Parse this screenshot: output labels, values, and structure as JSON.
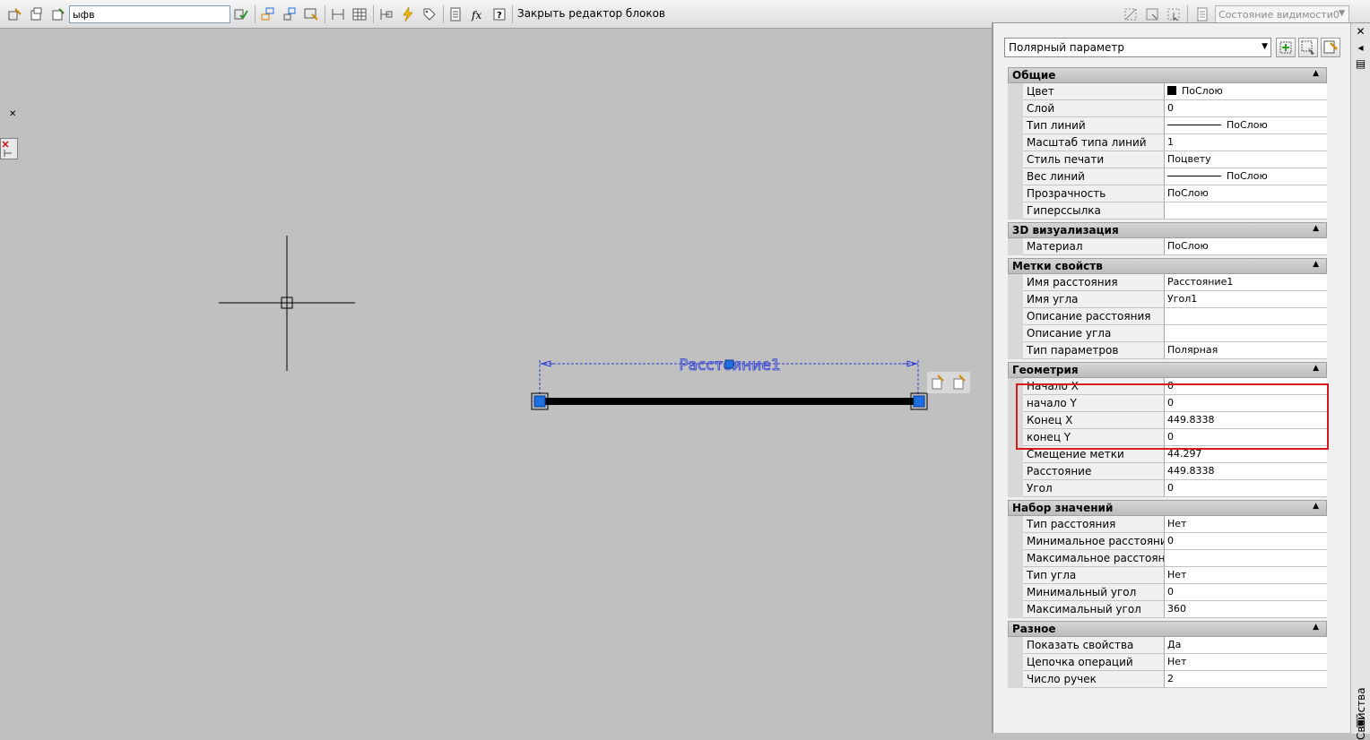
{
  "toolbar": {
    "block_name_value": "ыфв",
    "close_editor_label": "Закрыть редактор блоков",
    "visibility_state_value": "Состояние видимости0",
    "icons": [
      "edit-block-icon",
      "save-block-icon",
      "save-as-icon",
      "test-block-icon",
      "authoring-palette-icon",
      "parameter-sets-icon",
      "constraint-icon",
      "define-attribute-icon",
      "block-table-icon",
      "parameter-manager-icon",
      "lightning-icon",
      "tag-icon",
      "properties-icon",
      "fx-icon",
      "help-icon"
    ]
  },
  "drawing": {
    "parameter_label": "Расстояние1"
  },
  "properties": {
    "object_type": "Полярный параметр",
    "side_label": "Свойства",
    "categories": [
      {
        "title": "Общие",
        "rows": [
          {
            "name": "Цвет",
            "value": "ПоСлою",
            "kind": "color"
          },
          {
            "name": "Слой",
            "value": "0"
          },
          {
            "name": "Тип линий",
            "value": "ПоСлою",
            "kind": "line"
          },
          {
            "name": "Масштаб типа линий",
            "value": "1"
          },
          {
            "name": "Стиль печати",
            "value": "Поцвету"
          },
          {
            "name": "Вес линий",
            "value": "ПоСлою",
            "kind": "line"
          },
          {
            "name": "Прозрачность",
            "value": "ПоСлою"
          },
          {
            "name": "Гиперссылка",
            "value": ""
          }
        ]
      },
      {
        "title": "3D визуализация",
        "rows": [
          {
            "name": "Материал",
            "value": "ПоСлою"
          }
        ]
      },
      {
        "title": "Метки свойств",
        "rows": [
          {
            "name": "Имя расстояния",
            "value": "Расстояние1"
          },
          {
            "name": "Имя угла",
            "value": "Угол1"
          },
          {
            "name": "Описание расстояния",
            "value": ""
          },
          {
            "name": "Описание угла",
            "value": ""
          },
          {
            "name": "Тип параметров",
            "value": "Полярная"
          }
        ]
      },
      {
        "title": "Геометрия",
        "rows": [
          {
            "name": "Начало X",
            "value": "0"
          },
          {
            "name": "начало Y",
            "value": "0"
          },
          {
            "name": "Конец X",
            "value": "449.8338"
          },
          {
            "name": " конец Y",
            "value": "0"
          },
          {
            "name": "Смещение метки",
            "value": "44.297"
          },
          {
            "name": "Расстояние",
            "value": "449.8338"
          },
          {
            "name": "Угол",
            "value": "0"
          }
        ]
      },
      {
        "title": "Набор значений",
        "rows": [
          {
            "name": "Тип расстояния",
            "value": "Нет"
          },
          {
            "name": "Минимальное расстояние",
            "value": "0"
          },
          {
            "name": "Максимальное расстояние",
            "value": ""
          },
          {
            "name": "Тип угла",
            "value": "Нет"
          },
          {
            "name": "Минимальный угол",
            "value": "0"
          },
          {
            "name": "Максимальный угол",
            "value": "360"
          }
        ]
      },
      {
        "title": "Разное",
        "rows": [
          {
            "name": "Показать свойства",
            "value": "Да"
          },
          {
            "name": "Цепочка операций",
            "value": "Нет"
          },
          {
            "name": "Число ручек",
            "value": "2"
          }
        ]
      }
    ]
  },
  "colors": {
    "grip_blue": "#1e6fe0",
    "dim_blue": "#2a3cd6",
    "highlight_red": "#d61b1b",
    "canvas_gray": "#c0c0c0"
  }
}
